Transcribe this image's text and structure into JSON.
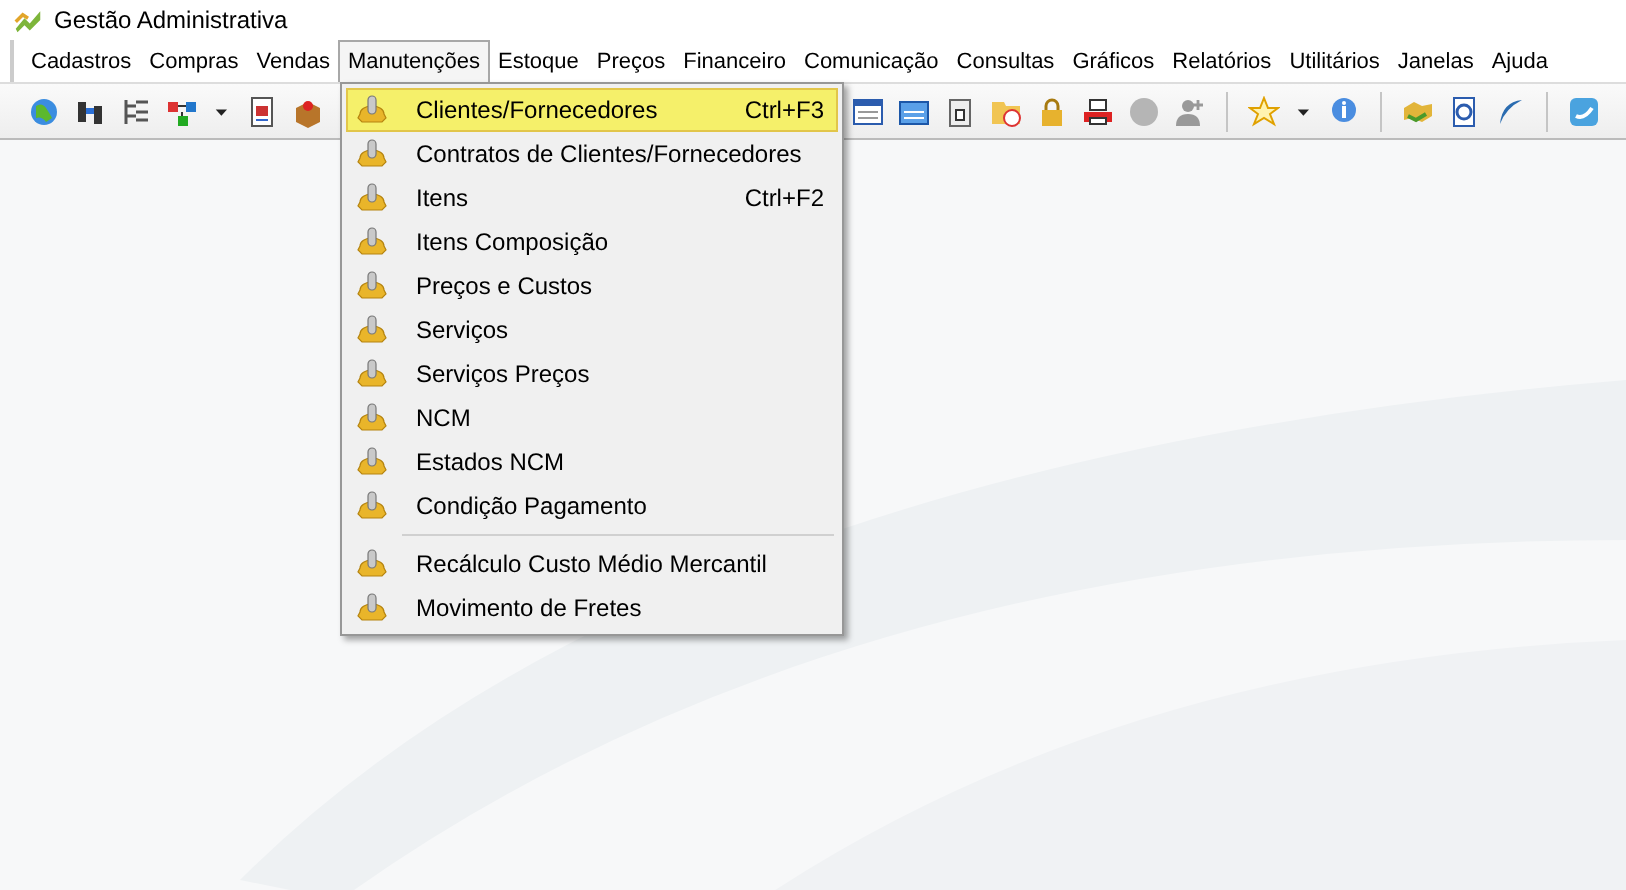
{
  "window": {
    "title": "Gestão Administrativa"
  },
  "menu_bar": [
    {
      "label": "Cadastros",
      "selected": false
    },
    {
      "label": "Compras",
      "selected": false
    },
    {
      "label": "Vendas",
      "selected": false
    },
    {
      "label": "Manutenções",
      "selected": true
    },
    {
      "label": "Estoque",
      "selected": false
    },
    {
      "label": "Preços",
      "selected": false
    },
    {
      "label": "Financeiro",
      "selected": false
    },
    {
      "label": "Comunicação",
      "selected": false
    },
    {
      "label": "Consultas",
      "selected": false
    },
    {
      "label": "Gráficos",
      "selected": false
    },
    {
      "label": "Relatórios",
      "selected": false
    },
    {
      "label": "Utilitários",
      "selected": false
    },
    {
      "label": "Janelas",
      "selected": false
    },
    {
      "label": "Ajuda",
      "selected": false
    }
  ],
  "dropdown": [
    {
      "kind": "item",
      "label": "Clientes/Fornecedores",
      "shortcut": "Ctrl+F3",
      "selected": true
    },
    {
      "kind": "item",
      "label": "Contratos de Clientes/Fornecedores",
      "selected": false
    },
    {
      "kind": "item",
      "label": "Itens",
      "shortcut": "Ctrl+F2",
      "selected": false
    },
    {
      "kind": "item",
      "label": "Itens Composição",
      "selected": false
    },
    {
      "kind": "item",
      "label": "Preços e Custos",
      "selected": false
    },
    {
      "kind": "item",
      "label": "Serviços",
      "selected": false
    },
    {
      "kind": "item",
      "label": "Serviços Preços",
      "selected": false
    },
    {
      "kind": "item",
      "label": "NCM",
      "selected": false
    },
    {
      "kind": "item",
      "label": "Estados NCM",
      "selected": false
    },
    {
      "kind": "item",
      "label": "Condição Pagamento",
      "selected": false
    },
    {
      "kind": "separator"
    },
    {
      "kind": "item",
      "label": "Recálculo Custo Médio Mercantil",
      "selected": false
    },
    {
      "kind": "item",
      "label": "Movimento de Fretes",
      "selected": false
    }
  ]
}
